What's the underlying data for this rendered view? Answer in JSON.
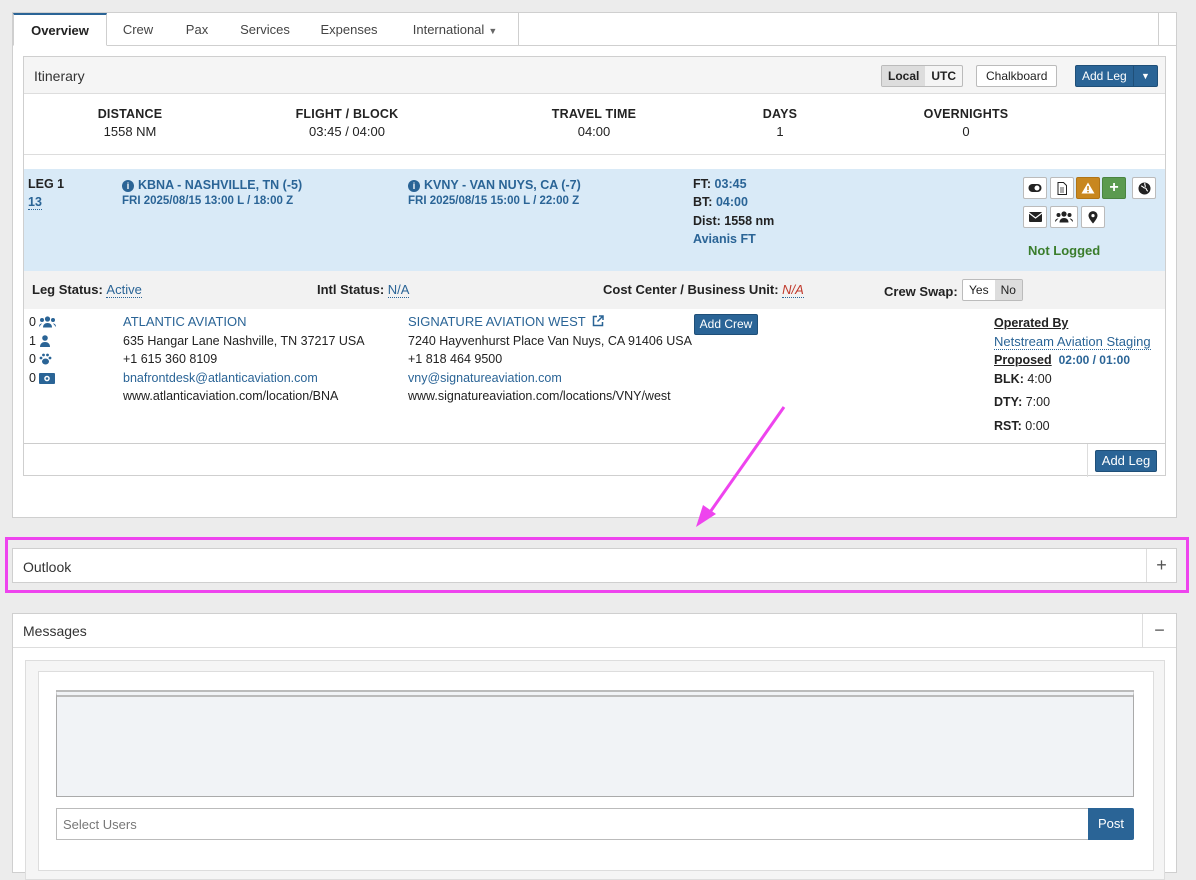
{
  "tabs": [
    "Overview",
    "Crew",
    "Pax",
    "Services",
    "Expenses",
    "International"
  ],
  "itinerary": {
    "title": "Itinerary",
    "time_modes": [
      "Local",
      "UTC"
    ],
    "selected_time_mode": "Local",
    "chalkboard_label": "Chalkboard",
    "add_leg_label": "Add Leg",
    "stats": [
      {
        "label": "DISTANCE",
        "value": "1558 NM"
      },
      {
        "label": "FLIGHT / BLOCK",
        "value": "03:45 / 04:00"
      },
      {
        "label": "TRAVEL TIME",
        "value": "04:00"
      },
      {
        "label": "DAYS",
        "value": "1"
      },
      {
        "label": "OVERNIGHTS",
        "value": "0"
      }
    ]
  },
  "leg": {
    "title": "LEG 1",
    "number": "13",
    "departure": {
      "airport": "KBNA - NASHVILLE, TN (-5)",
      "time": "FRI 2025/08/15 13:00 L / 18:00 Z"
    },
    "arrival": {
      "airport": "KVNY - VAN NUYS, CA (-7)",
      "time": "FRI 2025/08/15 15:00 L / 22:00 Z"
    },
    "ft_label": "FT:",
    "ft": "03:45",
    "bt_label": "BT:",
    "bt": "04:00",
    "dist": "Dist: 1558 nm",
    "source": "Avianis FT",
    "log_status": "Not Logged",
    "status_bar": {
      "leg_status_label": "Leg Status:",
      "leg_status": "Active",
      "intl_status_label": "Intl Status:",
      "intl_status": "N/A",
      "cost_center_label": "Cost Center / Business Unit:",
      "cost_center": "N/A",
      "crew_swap_label": "Crew Swap:",
      "crew_swap_options": [
        "Yes",
        "No"
      ],
      "crew_swap_selected": "No"
    },
    "counts": [
      "0",
      "1",
      "0",
      "0"
    ],
    "fbo_departure": {
      "name": "ATLANTIC AVIATION",
      "address": "635 Hangar Lane Nashville, TN 37217 USA",
      "phone": "+1 615 360 8109",
      "email": "bnafrontdesk@atlanticaviation.com",
      "website": "www.atlanticaviation.com/location/BNA"
    },
    "fbo_arrival": {
      "name": "SIGNATURE AVIATION WEST",
      "address": "7240 Hayvenhurst Place Van Nuys, CA 91406 USA",
      "phone": "+1 818 464 9500",
      "email": "vny@signatureaviation.com",
      "website": "www.signatureaviation.com/locations/VNY/west"
    },
    "add_crew_label": "Add Crew",
    "operated_by_label": "Operated By",
    "operator": "Netstream Aviation Staging",
    "proposed_label": "Proposed",
    "proposed": "02:00 / 01:00",
    "blk_label": "BLK:",
    "blk": "4:00",
    "dty_label": "DTY:",
    "dty": "7:00",
    "rst_label": "RST:",
    "rst": "0:00"
  },
  "footer_add_leg_label": "Add Leg",
  "outlook": {
    "title": "Outlook",
    "toggle": "+"
  },
  "messages": {
    "title": "Messages",
    "toggle": "−",
    "select_placeholder": "Select Users",
    "post_label": "Post"
  },
  "colors": {
    "accent": "#2a6496",
    "leg_band": "#d9eaf7",
    "highlight": "#ee44ee",
    "logged_status": "#3a7d2c",
    "warning": "#c8871f"
  }
}
